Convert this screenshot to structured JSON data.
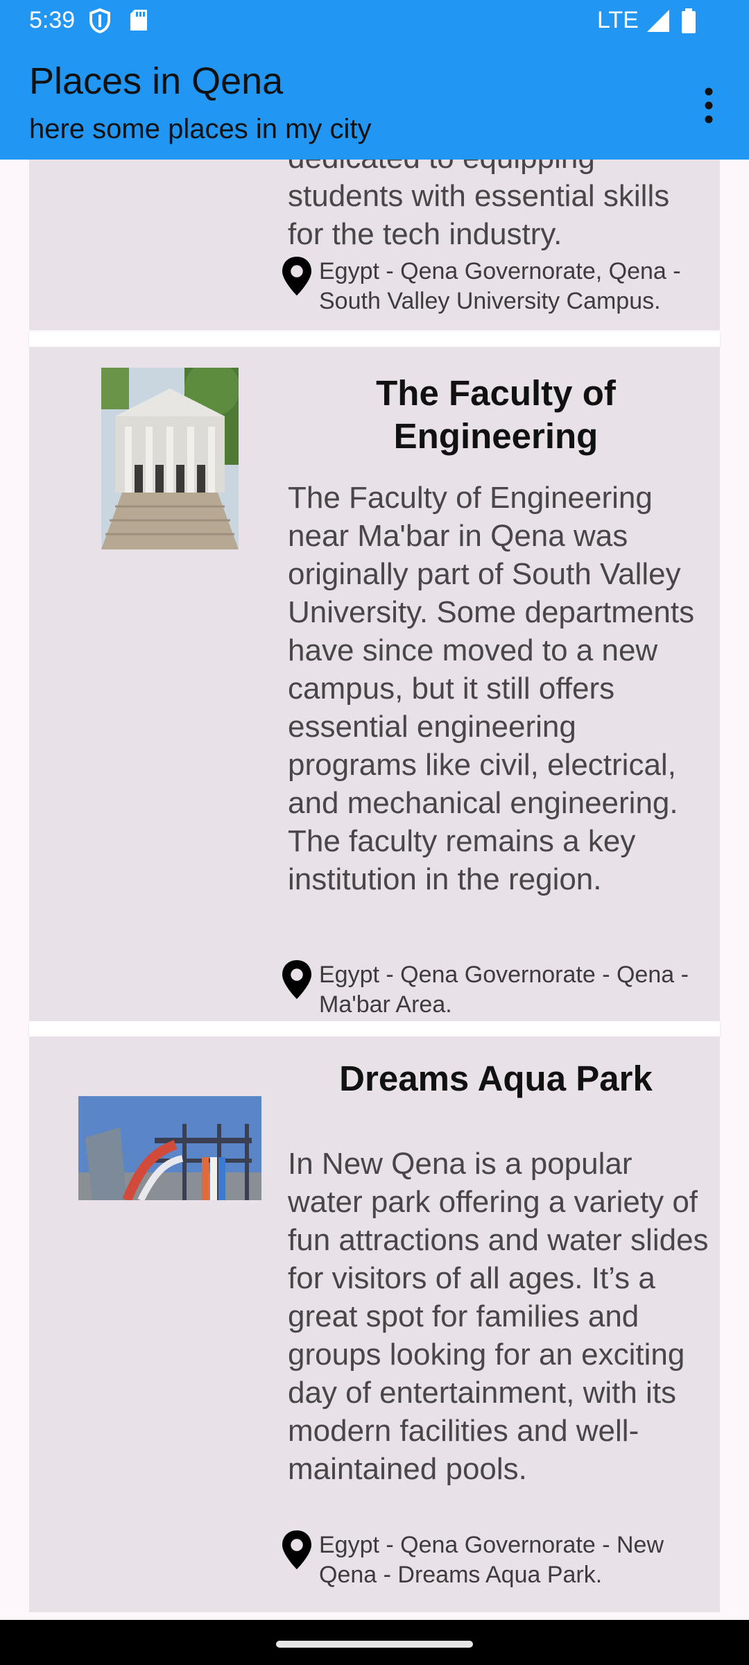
{
  "status_bar": {
    "time": "5:39",
    "network": "LTE",
    "icons": [
      "shield-icon",
      "sd-card-icon",
      "signal-icon",
      "battery-icon"
    ]
  },
  "app_bar": {
    "title": "Places in Qena",
    "subtitle": "here some places in my city",
    "menu_icon": "more-vertical-icon",
    "background": "#2196F3"
  },
  "places": [
    {
      "title": "",
      "description_tail": "dedicated to equipping students with essential skills for the tech industry.",
      "location": "Egypt - Qena Governorate, Qena - South Valley University Campus."
    },
    {
      "title": "The Faculty of Engineering",
      "description": "The Faculty of Engineering near Ma'bar in Qena was originally part of South Valley University. Some departments have since moved to a new campus, but it still offers essential engineering programs like civil, electrical, and mechanical engineering. The faculty remains a key institution in the region.",
      "location": "Egypt - Qena Governorate - Qena - Ma'bar Area."
    },
    {
      "title": "Dreams Aqua Park",
      "description": "In New Qena is a popular water park offering a variety of fun attractions and water slides for visitors of all ages. It’s a great spot for families and groups looking for an exciting day of entertainment, with its modern facilities and well-maintained pools.",
      "location": "Egypt - Qena Governorate - New Qena - Dreams Aqua Park."
    }
  ],
  "colors": {
    "card_background": "#E8E2E8",
    "page_background": "#FDF7FC",
    "description_text": "#4a4549"
  }
}
